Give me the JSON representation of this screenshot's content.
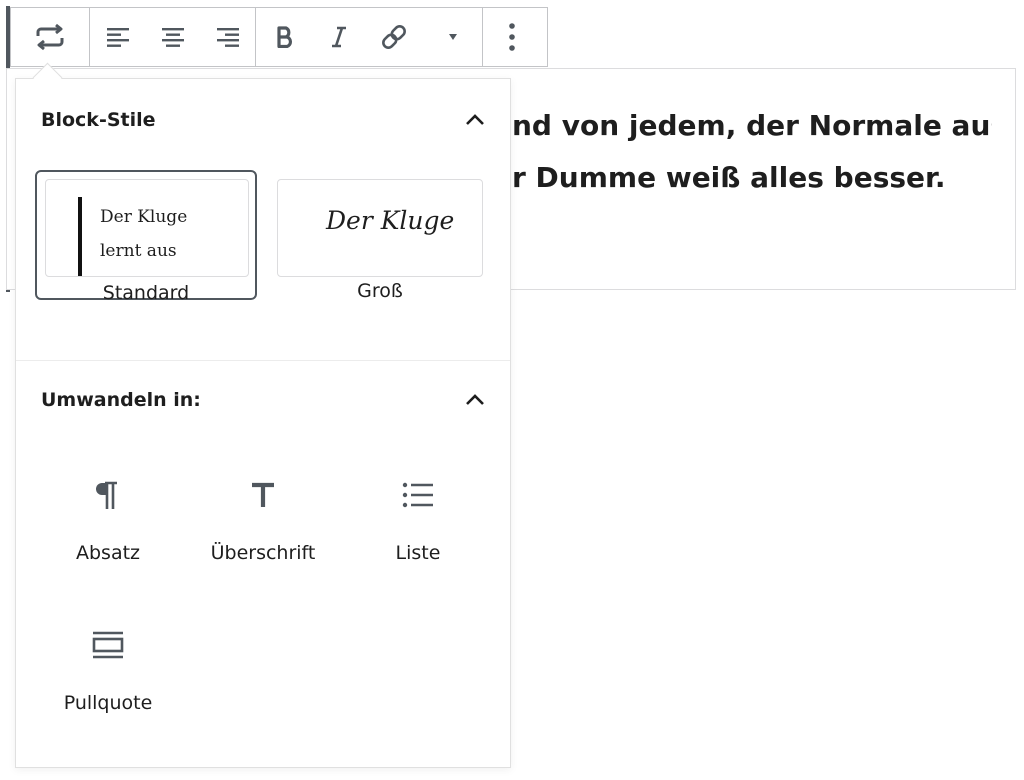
{
  "quote": {
    "line1": "nd von jedem, der Normale aus",
    "line2": "r Dumme weiß alles besser."
  },
  "toolbar": {
    "buttons": [
      {
        "name": "transform-icon"
      },
      {
        "name": "align-left-icon"
      },
      {
        "name": "align-center-icon"
      },
      {
        "name": "align-right-icon"
      },
      {
        "name": "bold-icon"
      },
      {
        "name": "italic-icon"
      },
      {
        "name": "link-icon"
      },
      {
        "name": "caret-down-icon"
      },
      {
        "name": "more-vertical-icon"
      }
    ]
  },
  "popover": {
    "block_styles": {
      "title": "Block-Stile",
      "styles": [
        {
          "label": "Standard",
          "preview": "Der Kluge lernt aus allem und",
          "active": true
        },
        {
          "label": "Groß",
          "preview": "Der Kluge",
          "active": false
        }
      ]
    },
    "transform": {
      "title": "Umwandeln in:",
      "items": [
        {
          "label": "Absatz",
          "icon": "paragraph-icon"
        },
        {
          "label": "Überschrift",
          "icon": "heading-icon"
        },
        {
          "label": "Liste",
          "icon": "list-icon"
        },
        {
          "label": "Pullquote",
          "icon": "pullquote-icon"
        }
      ]
    }
  },
  "colors": {
    "icon": "#50575e",
    "border": "#c3c4c7",
    "text": "#1e1e1e"
  }
}
